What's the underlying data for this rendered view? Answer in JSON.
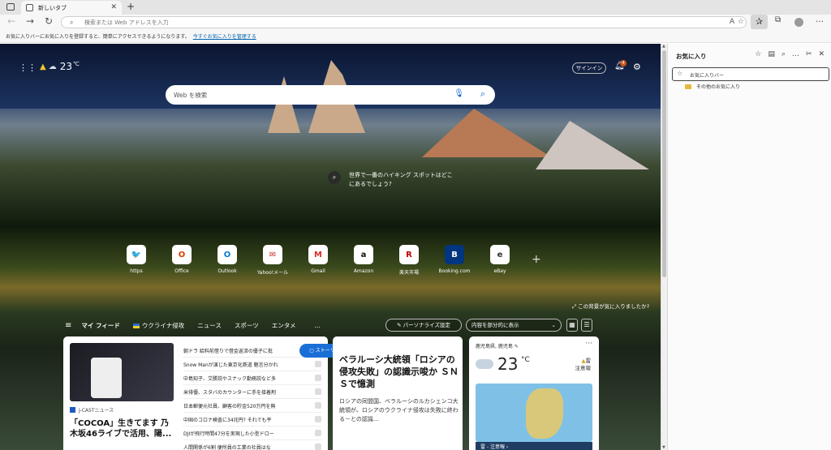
{
  "browser": {
    "tab_title": "新しいタブ",
    "address_placeholder": "検索または Web アドレスを入力",
    "favorites_bar_text": "お気に入りバーにお気に入りを登録すると、簡単にアクセスできるようになります。",
    "favorites_bar_link": "今すぐお気に入りを管理する"
  },
  "favorites_panel": {
    "title": "お気に入り",
    "items": [
      {
        "label": "お気に入りバー"
      },
      {
        "label": "その他のお気に入り"
      }
    ]
  },
  "newtab": {
    "weather_top": {
      "temp": "23",
      "unit": "℃"
    },
    "signin_label": "サインイン",
    "notification_count": "4",
    "search_placeholder": "Web を検索",
    "image_caption": {
      "line1": "世界で一番のハイキング スポットはどこ",
      "line2": "にあるでしょう?"
    },
    "tiles": [
      {
        "label": "https",
        "glyph": "🐦",
        "color": "#1da1f2"
      },
      {
        "label": "Office",
        "glyph": "O",
        "color": "#d83b01"
      },
      {
        "label": "Outlook",
        "glyph": "O",
        "color": "#0078d4"
      },
      {
        "label": "Yahoo!メール",
        "glyph": "✉",
        "color": "#c33"
      },
      {
        "label": "Gmail",
        "glyph": "M",
        "color": "#d93025"
      },
      {
        "label": "Amazon",
        "glyph": "a",
        "color": "#111"
      },
      {
        "label": "楽天市場",
        "glyph": "R",
        "color": "#bf0000"
      },
      {
        "label": "Booking.com",
        "glyph": "B",
        "color": "#003580"
      },
      {
        "label": "eBay",
        "glyph": "e",
        "color": "#333"
      }
    ],
    "like_background": "この背景が気に入りましたか?",
    "feed_nav": {
      "my_feed": "マイ フィード",
      "items": [
        "ウクライナ侵攻",
        "ニュース",
        "スポーツ",
        "エンタメ"
      ],
      "more": "…",
      "personalize": "パーソナライズ設定",
      "display_option": "内容を部分的に表示"
    },
    "stories_button": "ストーリーの更新"
  },
  "card1": {
    "source": "J-CASTニュース",
    "headline": "「COCOA」生きてます 乃木坂46ライブで活用、陽...",
    "list": [
      {
        "text": "朝ドラ 給料前借りで借金返済の優子に批"
      },
      {
        "text": "Snow Manが演じた東京化鉄道 魅言分かれ"
      },
      {
        "text": "中島知子、艾勝説やスナック勤務説など多"
      },
      {
        "text": "米俳優、スタバのカウンターに手を接着剤"
      },
      {
        "text": "日本郵便元社員、顧客の貯金520万円を無"
      },
      {
        "text": "中国のコロナ検査に34兆円? それでも平"
      },
      {
        "text": "DJIが飛行時間47分を実現した小型ドロー"
      },
      {
        "text": "人間関係が6割 便所員の工業の社員はな"
      }
    ]
  },
  "card2": {
    "source": "",
    "headline": "ベラルーシ大統領「ロシアの侵攻失敗」の認識示唆か ＳＮＳで憶測",
    "body": "ロシアの同盟国、ベラルーシのルカシェンコ大統領が、ロシアのウクライナ侵攻は失敗に終わる－との認識..."
  },
  "card3": {
    "location": "鹿児島県, 鹿児島",
    "temp": "23",
    "unit": "°C",
    "condition": "雷",
    "advisory": "注意報",
    "map_bar": "雷 - 注意報 ›"
  }
}
